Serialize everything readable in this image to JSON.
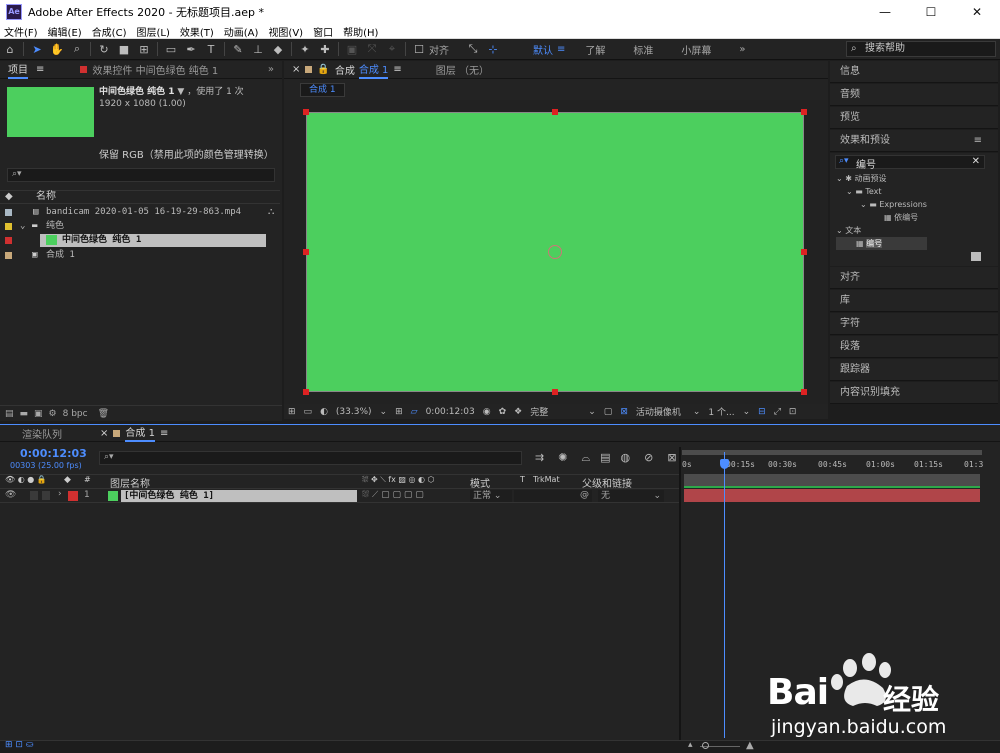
{
  "window": {
    "title": "Adobe After Effects 2020 - 无标题项目.aep *",
    "app_icon": "Ae",
    "min": "—",
    "max": "☐",
    "close": "✕"
  },
  "menu": [
    "文件(F)",
    "编辑(E)",
    "合成(C)",
    "图层(L)",
    "效果(T)",
    "动画(A)",
    "视图(V)",
    "窗口",
    "帮助(H)"
  ],
  "toolbar": {
    "align_label": "对齐",
    "workspaces": [
      "默认",
      "了解",
      "标准",
      "小屏幕"
    ],
    "active_workspace": "默认",
    "more": "»",
    "search_help": "搜索帮助"
  },
  "project_panel": {
    "tab_project": "项目",
    "tab_effects": "效果控件 中间色绿色 纯色 1",
    "selected_name": "中间色绿色 纯色 1",
    "usage": "，使用了 1 次",
    "dimensions": "1920 x 1080 (1.00)",
    "color_note": "保留 RGB（禁用此项的颜色管理转换）",
    "col_name": "名称",
    "items": [
      {
        "name": "bandicam 2020-01-05 16-19-29-863.mp4",
        "label_color": "#a9b8c4"
      },
      {
        "name": "纯色",
        "label_color": "#e0c030"
      },
      {
        "name": "中间色绿色 纯色 1",
        "label_color": "#d03030"
      },
      {
        "name": "合成 1",
        "label_color": "#c8a87a"
      }
    ],
    "bpc": "8 bpc"
  },
  "comp_panel": {
    "tab_comp": "合成",
    "comp_name": "合成 1",
    "tab_layer": "图层 （无）",
    "breadcrumb": "合成 1",
    "zoom": "(33.3%)",
    "timecode": "0:00:12:03",
    "resolution": "完整",
    "camera": "活动摄像机",
    "views": "1 个...",
    "canvas_color": "#4ccf5e"
  },
  "right_panels": {
    "items_top": [
      "信息",
      "音频",
      "预览"
    ],
    "effects_title": "效果和预设",
    "effects_search": "编号",
    "tree": [
      "动画预设",
      "Text",
      "Expressions",
      "依编号",
      "文本",
      "编号"
    ],
    "items_bottom": [
      "对齐",
      "库",
      "字符",
      "段落",
      "跟踪器",
      "内容识别填充"
    ]
  },
  "timeline": {
    "tab_render": "渲染队列",
    "tab_comp": "合成 1",
    "timecode": "0:00:12:03",
    "frames": "00303 (25.00 fps)",
    "col_layer_name": "图层名称",
    "col_mode": "模式",
    "col_t": "T",
    "col_trkmat": "TrkMat",
    "col_parent": "父级和链接",
    "layer_index": "1",
    "layer_name": "[中间色绿色 纯色 1]",
    "layer_mode": "正常",
    "layer_parent": "无",
    "ruler_ticks": [
      "0s",
      "00:15s",
      "00:30s",
      "00:45s",
      "01:00s",
      "01:15s",
      "01:3"
    ]
  },
  "watermark": {
    "logo_text": "Bai",
    "logo_suffix": "经验",
    "url": "jingyan.baidu.com"
  }
}
